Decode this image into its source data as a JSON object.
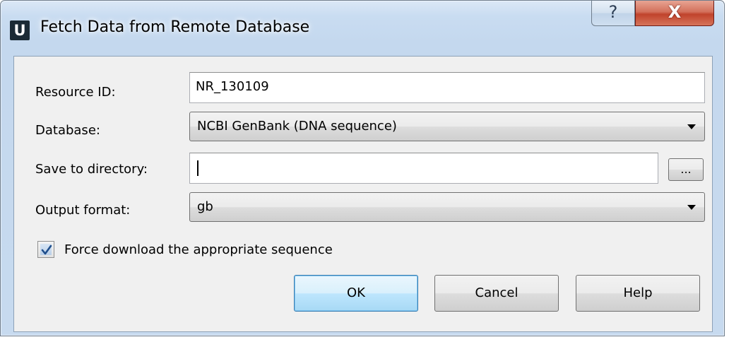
{
  "window": {
    "title": "Fetch Data from Remote Database",
    "app_icon_letter": "U",
    "help_button_glyph": "?",
    "close_button_glyph": "X"
  },
  "form": {
    "resource_id": {
      "label": "Resource ID:",
      "value": "NR_130109"
    },
    "database": {
      "label": "Database:",
      "selected": "NCBI GenBank (DNA sequence)"
    },
    "save_directory": {
      "label": "Save to directory:",
      "value": "",
      "browse_label": "..."
    },
    "output_format": {
      "label": "Output format:",
      "selected": "gb"
    },
    "force_download": {
      "label": "Force download the appropriate sequence",
      "checked": true
    }
  },
  "buttons": {
    "ok": "OK",
    "cancel": "Cancel",
    "help": "Help"
  },
  "colors": {
    "default_button_border": "#3c7fb1",
    "close_button": "#c0432c",
    "checkmark": "#1f4e8c"
  }
}
